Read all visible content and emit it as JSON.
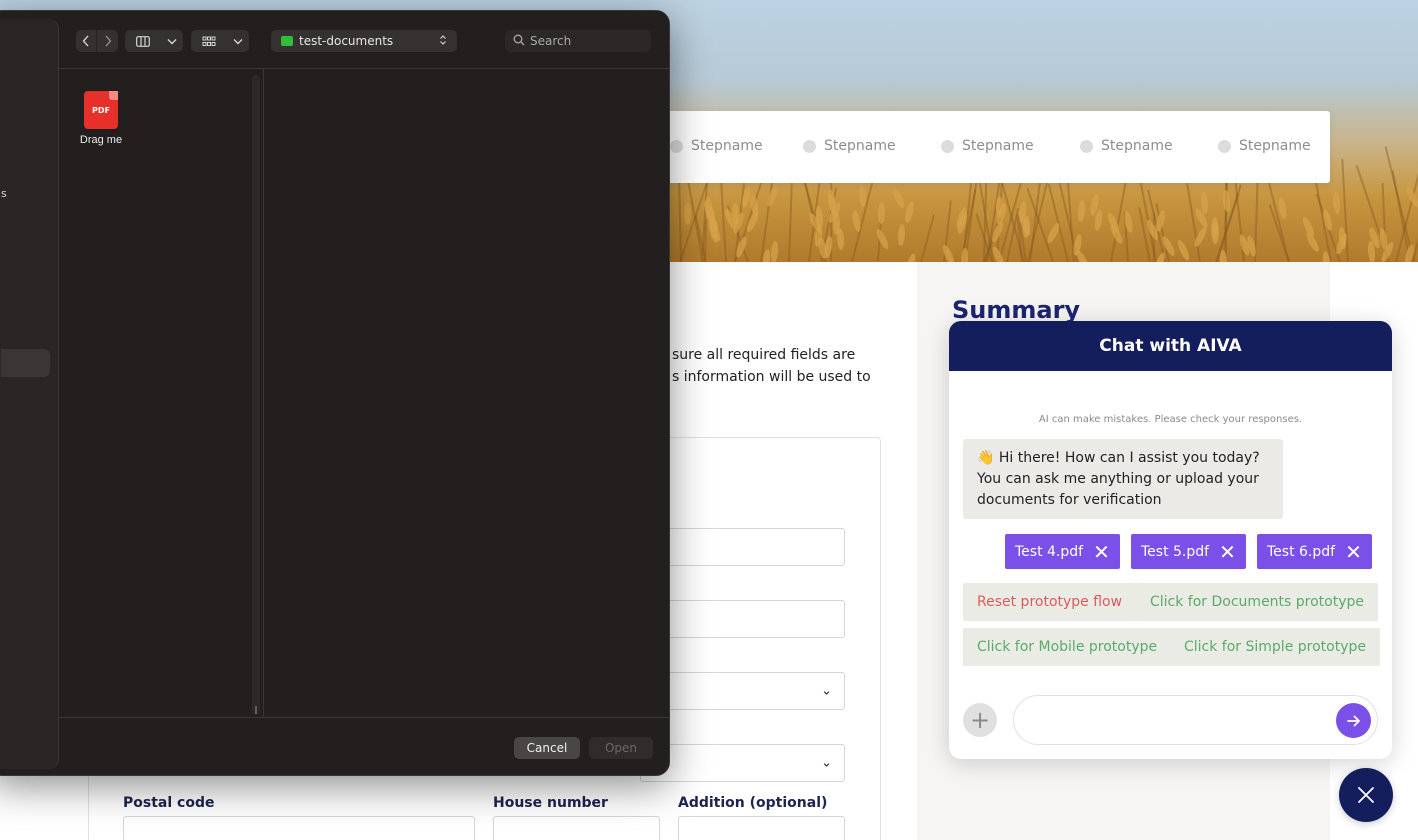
{
  "page": {
    "stepper": {
      "steps": [
        {
          "label": "Stepname"
        },
        {
          "label": "Stepname"
        },
        {
          "label": "Stepname"
        },
        {
          "label": "Stepname"
        },
        {
          "label": "Stepname"
        }
      ]
    },
    "summary_title": "Summary",
    "intro_lines": [
      "sure all required fields are",
      "s information will be used to"
    ],
    "form": {
      "postal_code_label": "Postal code",
      "house_number_label": "House number",
      "addition_label": "Addition (optional)"
    }
  },
  "finder": {
    "sidebar_fragment": "s",
    "path": "test-documents",
    "search_placeholder": "Search",
    "files": [
      {
        "name": "Drag me",
        "badge": "PDF"
      }
    ],
    "cancel_label": "Cancel",
    "open_label": "Open"
  },
  "chat": {
    "title": "Chat with AIVA",
    "disclaimer": "AI can make mistakes. Please check your responses.",
    "bot_message": "👋 Hi there! How can I assist you today? You can ask me anything or upload your documents for verification",
    "attachments": [
      {
        "name": "Test 4.pdf"
      },
      {
        "name": "Test 5.pdf"
      },
      {
        "name": "Test 6.pdf"
      }
    ],
    "suggestions": [
      {
        "label": "Reset prototype flow"
      },
      {
        "label": "Click for Documents prototype"
      },
      {
        "label": "Click for Mobile prototype"
      },
      {
        "label": "Click for Simple prototype"
      }
    ],
    "input_value": ""
  },
  "colors": {
    "brand_navy": "#151e5c",
    "accent_purple": "#7b50e8",
    "reset_red": "#e05a5a",
    "suggestion_green": "#5aab6a",
    "pdf_red": "#e8302a",
    "folder_green": "#2fbf3a"
  },
  "icons": {
    "nav_back": "chevron-left-icon",
    "nav_forward": "chevron-right-icon",
    "column_view": "column-view-icon",
    "group": "grid-icon",
    "search": "search-icon",
    "remove_attachment": "close-icon",
    "attach": "plus-icon",
    "send": "arrow-right-icon",
    "close_chat": "close-icon"
  }
}
